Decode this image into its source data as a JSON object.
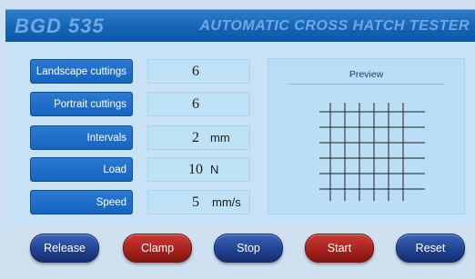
{
  "header": {
    "model": "BGD 535",
    "title": "AUTOMATIC CROSS HATCH TESTER"
  },
  "params": [
    {
      "label": "Landscape cuttings",
      "value": "6",
      "unit": ""
    },
    {
      "label": "Portrait cuttings",
      "value": "6",
      "unit": ""
    },
    {
      "label": "Intervals",
      "value": "2",
      "unit": "mm"
    },
    {
      "label": "Load",
      "value": "10",
      "unit": "N"
    },
    {
      "label": "Speed",
      "value": "5",
      "unit": "mm/s"
    }
  ],
  "preview": {
    "title": "Preview",
    "vertical_lines": 6,
    "horizontal_lines": 6
  },
  "buttons": {
    "release": "Release",
    "clamp": "Clamp",
    "stop": "Stop",
    "start": "Start",
    "reset": "Reset"
  },
  "colors": {
    "header": "#1565b5",
    "label_bg": "#1565c0",
    "value_bg": "#bfe1f6",
    "button_blue": "#1f3f8f",
    "button_red": "#a3201d"
  }
}
